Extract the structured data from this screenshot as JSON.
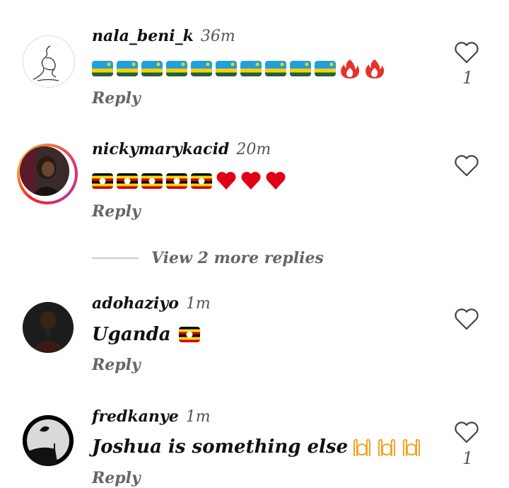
{
  "comments": [
    {
      "username": "nala_beni_k",
      "time": "36m",
      "emoji": [
        "rwanda-flag",
        "rwanda-flag",
        "rwanda-flag",
        "rwanda-flag",
        "rwanda-flag",
        "rwanda-flag",
        "rwanda-flag",
        "rwanda-flag",
        "rwanda-flag",
        "rwanda-flag",
        "fire-icon",
        "fire-icon"
      ],
      "reply_label": "Reply",
      "likes": "1"
    },
    {
      "username": "nickymarykacid",
      "time": "20m",
      "emoji": [
        "uganda-flag",
        "uganda-flag",
        "uganda-flag",
        "uganda-flag",
        "uganda-flag",
        "red-heart-icon",
        "red-heart-icon",
        "red-heart-icon"
      ],
      "reply_label": "Reply",
      "view_more": "View 2 more replies"
    },
    {
      "username": "adohaziyo",
      "time": "1m",
      "text": "Uganda",
      "reply_label": "Reply"
    },
    {
      "username": "fredkanye",
      "time": "1m",
      "text": "Joshua is something else",
      "emoji": [
        "raising-hands-icon",
        "raising-hands-icon",
        "raising-hands-icon"
      ],
      "reply_label": "Reply",
      "likes": "1"
    }
  ],
  "colors": {
    "rwanda_blue": "#20a0de",
    "rwanda_yellow": "#fad201",
    "rwanda_green": "#20603d",
    "uganda_black": "#000000",
    "uganda_yellow": "#fcdc04",
    "uganda_red": "#d90000",
    "heart_red": "#e00016",
    "fire_red": "#e5322d"
  }
}
